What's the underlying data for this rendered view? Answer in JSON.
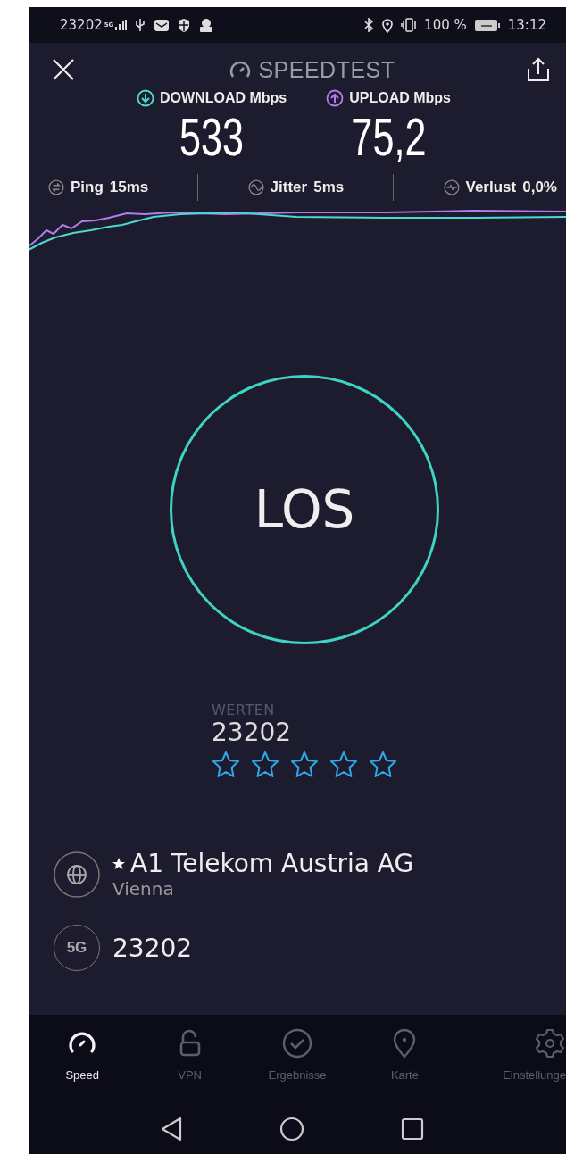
{
  "status_bar": {
    "carrier": "23202",
    "signal_tag": "5G",
    "battery": "100 %",
    "time": "13:12"
  },
  "header": {
    "title": "SPEEDTEST"
  },
  "results": [
    {
      "kind": "download",
      "label": "DOWNLOAD Mbps",
      "value": "533",
      "color": "#4dd9cf"
    },
    {
      "kind": "upload",
      "label": "UPLOAD Mbps",
      "value": "75,2",
      "color": "#b57bf0"
    }
  ],
  "stats": [
    {
      "kind": "ping",
      "label": "Ping",
      "value": "15ms"
    },
    {
      "kind": "jitter",
      "label": "Jitter",
      "value": "5ms"
    },
    {
      "kind": "loss",
      "label": "Verlust",
      "value": "0,0%"
    }
  ],
  "go_button": "LOS",
  "rating": {
    "label": "WERTEN",
    "code": "23202",
    "stars": 0
  },
  "provider": {
    "name": "A1 Telekom Austria AG",
    "favorite": true,
    "city": "Vienna"
  },
  "network": {
    "badge": "5G",
    "code": "23202"
  },
  "nav": [
    {
      "kind": "speed",
      "label": "Speed",
      "selected": true
    },
    {
      "kind": "vpn",
      "label": "VPN",
      "selected": false
    },
    {
      "kind": "results",
      "label": "Ergebnisse",
      "selected": false
    },
    {
      "kind": "map",
      "label": "Karte",
      "selected": false
    },
    {
      "kind": "settings",
      "label": "Einstellunge",
      "selected": false
    }
  ]
}
